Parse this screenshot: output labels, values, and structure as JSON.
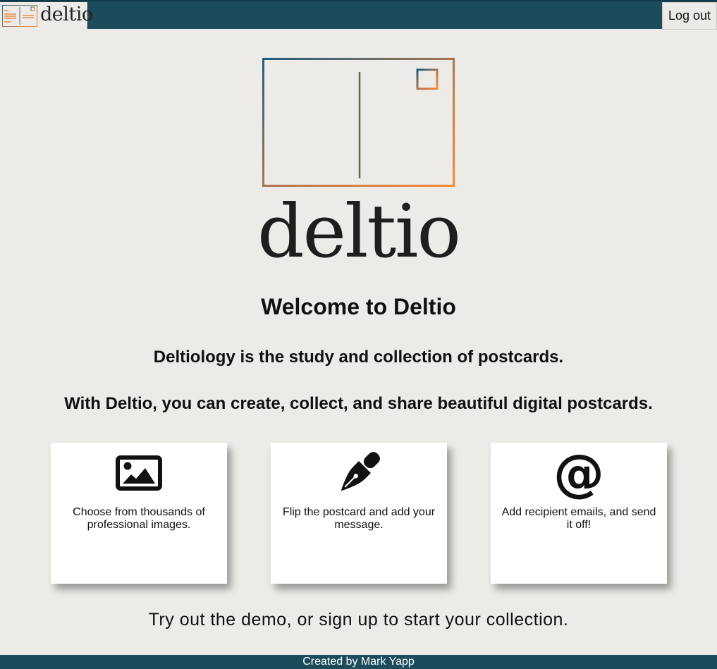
{
  "nav": {
    "brand": "deltio",
    "logout_label": "Log out"
  },
  "hero": {
    "wordmark": "deltio",
    "welcome": "Welcome to Deltio",
    "intro_1": "Deltiology is the study and collection of postcards.",
    "intro_2": "With Deltio, you can create, collect, and share beautiful digital postcards."
  },
  "features": [
    {
      "icon": "image-icon",
      "text": "Choose from thousands of professional images."
    },
    {
      "icon": "fountain-pen-icon",
      "text": "Flip the postcard and add your message."
    },
    {
      "icon": "at-sign-icon",
      "glyph": "@",
      "text": "Add recipient emails, and send it off!"
    }
  ],
  "cta": "Try out the demo, or sign up to start your collection.",
  "footer": "Created by Mark Yapp",
  "colors": {
    "nav_bg": "#1c4c5c",
    "page_bg": "#ecebe7",
    "gradient_start": "#1f5f7c",
    "gradient_end": "#f48a3a"
  }
}
